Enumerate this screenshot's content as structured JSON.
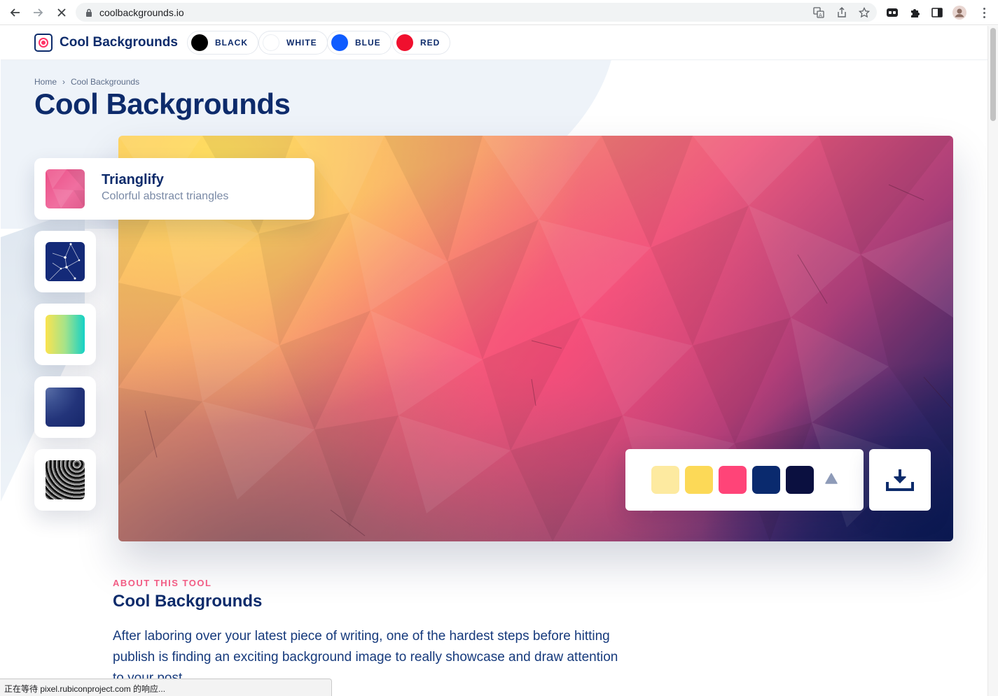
{
  "browser": {
    "url": "coolbackgrounds.io",
    "status": "正在等待 pixel.rubiconproject.com 的响应..."
  },
  "header": {
    "logo_text": "Cool Backgrounds",
    "color_filters": [
      {
        "label": "BLACK",
        "color": "#000000"
      },
      {
        "label": "WHITE",
        "color": "#ffffff"
      },
      {
        "label": "BLUE",
        "color": "#0f5cff"
      },
      {
        "label": "RED",
        "color": "#f0102e"
      }
    ]
  },
  "breadcrumb": {
    "home": "Home",
    "separator": "›",
    "current": "Cool Backgrounds"
  },
  "page_title": "Cool Backgrounds",
  "selected_tool": {
    "title": "Trianglify",
    "subtitle": "Colorful abstract triangles"
  },
  "tools": [
    {
      "name": "particles",
      "icon": "constellation-thumbnail"
    },
    {
      "name": "gradient",
      "icon": "gradient-thumbnail"
    },
    {
      "name": "layers",
      "icon": "layered-waves-thumbnail"
    },
    {
      "name": "3d-waves",
      "icon": "monochrome-waves-thumbnail"
    }
  ],
  "palette": {
    "colors": [
      "#fdeaa0",
      "#fcd957",
      "#ff4478",
      "#0a2a6e",
      "#0b1040"
    ],
    "shape_icon": "triangle-icon",
    "download_icon": "download-icon"
  },
  "about": {
    "kicker": "ABOUT THIS TOOL",
    "title": "Cool Backgrounds",
    "body": "After laboring over your latest piece of writing, one of the hardest steps before hitting publish is finding an exciting background image to really showcase and draw attention to your post."
  },
  "theme": {
    "navy": "#0d2b6b",
    "accent_pink": "#f25c84"
  }
}
